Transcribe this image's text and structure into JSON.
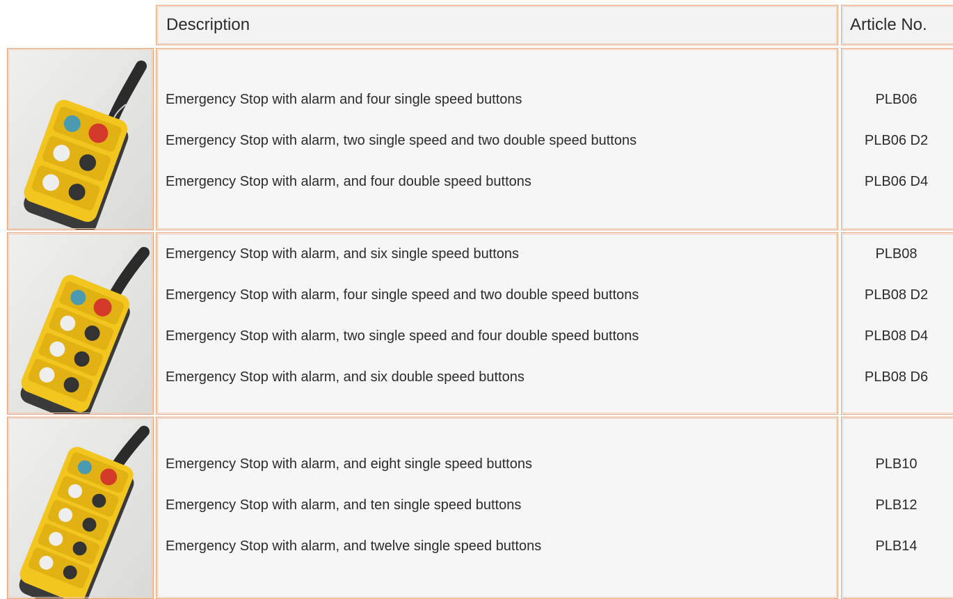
{
  "header": {
    "description": "Description",
    "article": "Article No."
  },
  "colors": {
    "border": "#e5a07a",
    "pendant_yellow": "#f2c51f",
    "estop_red": "#d43a2a"
  },
  "rows": [
    {
      "image": "pendant-control-4-buttons",
      "items": [
        {
          "description": "Emergency Stop with alarm and four single speed buttons",
          "article": "PLB06"
        },
        {
          "description": "Emergency Stop with alarm, two single speed and two double speed buttons",
          "article": "PLB06 D2"
        },
        {
          "description": "Emergency Stop with alarm, and four double speed buttons",
          "article": "PLB06 D4"
        }
      ]
    },
    {
      "image": "pendant-control-6-buttons",
      "items": [
        {
          "description": "Emergency Stop with alarm, and six single speed buttons",
          "article": "PLB08"
        },
        {
          "description": "Emergency Stop with alarm, four single speed and two double speed buttons",
          "article": "PLB08 D2"
        },
        {
          "description": "Emergency Stop with alarm, two single speed and four double speed buttons",
          "article": "PLB08 D4"
        },
        {
          "description": "Emergency Stop with alarm, and six double speed buttons",
          "article": "PLB08 D6"
        }
      ]
    },
    {
      "image": "pendant-control-8-buttons",
      "items": [
        {
          "description": "Emergency Stop with alarm, and eight single speed buttons",
          "article": "PLB10"
        },
        {
          "description": "Emergency Stop with alarm, and ten single speed buttons",
          "article": "PLB12"
        },
        {
          "description": "Emergency Stop with alarm, and twelve single speed buttons",
          "article": "PLB14"
        }
      ]
    }
  ]
}
